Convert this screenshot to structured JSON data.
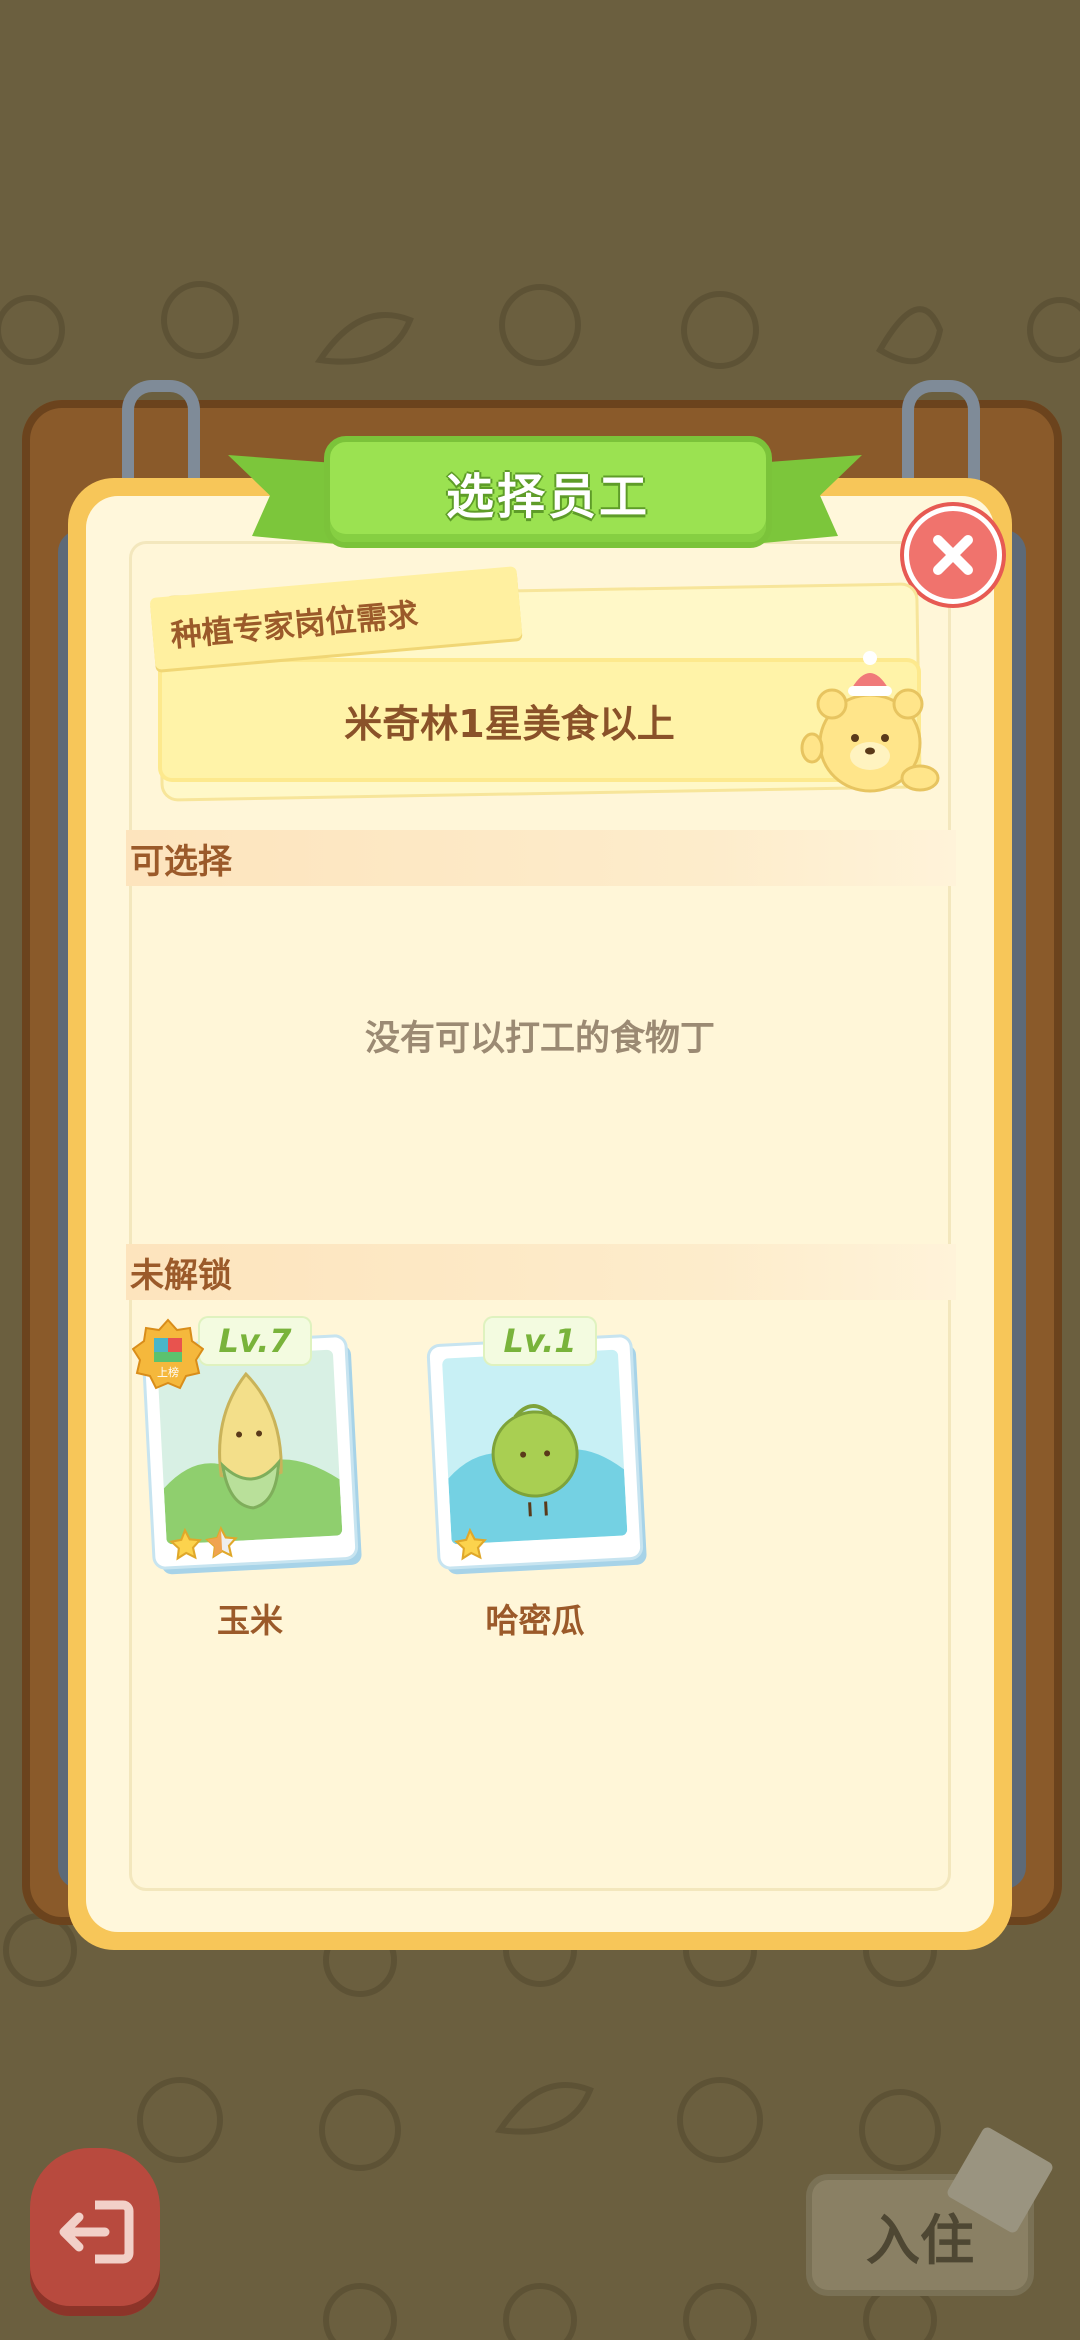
{
  "dialog": {
    "title": "选择员工",
    "requirement_tag": "种植专家岗位需求",
    "requirement_text": "米奇林1星美食以上"
  },
  "sections": {
    "available": {
      "header": "可选择",
      "empty_message": "没有可以打工的食物丁"
    },
    "locked": {
      "header": "未解锁",
      "characters": [
        {
          "name": "玉米",
          "level": "Lv.7",
          "stars": 1.5,
          "badge": "上榜",
          "scene_color": "#c9ecd9"
        },
        {
          "name": "哈密瓜",
          "level": "Lv.1",
          "stars": 1,
          "badge": "",
          "scene_color": "#c3ecf2"
        }
      ]
    }
  },
  "buttons": {
    "check_in": "入住"
  },
  "colors": {
    "ribbon_green": "#9be251",
    "close_red": "#f0736d",
    "text_brown": "#9b5a2a",
    "card_yellow": "#f7c659"
  },
  "icons": [
    "close-icon",
    "exit-icon",
    "bear-mascot-icon",
    "star-icon",
    "rank-badge-icon"
  ]
}
